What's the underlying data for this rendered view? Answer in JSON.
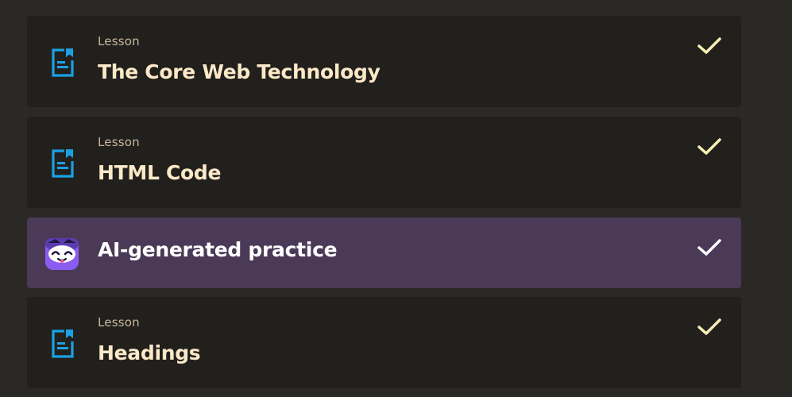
{
  "items": [
    {
      "type": "lesson",
      "label": "Lesson",
      "title": "The Core Web Technology",
      "completed": true,
      "icon": "lesson-document-icon"
    },
    {
      "type": "lesson",
      "label": "Lesson",
      "title": "HTML Code",
      "completed": true,
      "icon": "lesson-document-icon"
    },
    {
      "type": "practice",
      "label": "",
      "title": "AI-generated practice",
      "completed": true,
      "icon": "ai-mascot-icon"
    },
    {
      "type": "lesson",
      "label": "Lesson",
      "title": "Headings",
      "completed": true,
      "icon": "lesson-document-icon"
    }
  ],
  "colors": {
    "page_background": "#2b2926",
    "card_background": "#22201d",
    "ai_card_background": "#4b3a57",
    "lesson_icon": "#1ba1e2",
    "check_lesson": "#f6f0b4",
    "check_ai": "#ffffff",
    "title_text": "#fbe9c8",
    "label_text": "#c9b8a0"
  }
}
